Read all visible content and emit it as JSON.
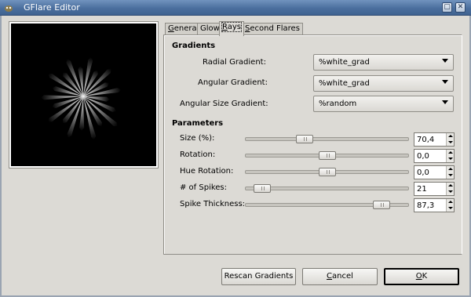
{
  "window": {
    "title": "GFlare Editor",
    "min_glyph": "▢",
    "close_glyph": "✕"
  },
  "tabs": [
    {
      "label": "General",
      "mnemonic": "G",
      "rest": "eneral"
    },
    {
      "label": "Glow",
      "mnemonic": "",
      "rest": "Glow"
    },
    {
      "label": "Rays",
      "mnemonic": "R",
      "rest": "ays",
      "active": true
    },
    {
      "label": "Second Flares",
      "mnemonic": "S",
      "rest": "econd Flares"
    }
  ],
  "gradients": {
    "heading": "Gradients",
    "radial_label": "Radial Gradient:",
    "radial_value": "%white_grad",
    "angular_label": "Angular Gradient:",
    "angular_value": "%white_grad",
    "angular_size_label": "Angular Size Gradient:",
    "angular_size_value": "%random"
  },
  "parameters": {
    "heading": "Parameters",
    "rows": [
      {
        "label": "Size (%):",
        "value": "70,4",
        "level": 0.35
      },
      {
        "label": "Rotation:",
        "value": "0,0",
        "level": 0.5
      },
      {
        "label": "Hue Rotation:",
        "value": "0,0",
        "level": 0.5
      },
      {
        "label": "# of Spikes:",
        "value": "21",
        "level": 0.06
      },
      {
        "label": "Spike Thickness:",
        "value": "87,3",
        "level": 0.87
      }
    ]
  },
  "buttons": {
    "rescan": "Rescan Gradients",
    "cancel_mnemonic": "C",
    "cancel_rest": "ancel",
    "ok_mnemonic": "O",
    "ok_rest": "K"
  },
  "colors": {
    "titlebar": "#4b6f9e",
    "preview_bg": "#000000",
    "window_bg": "#dcdad5"
  }
}
